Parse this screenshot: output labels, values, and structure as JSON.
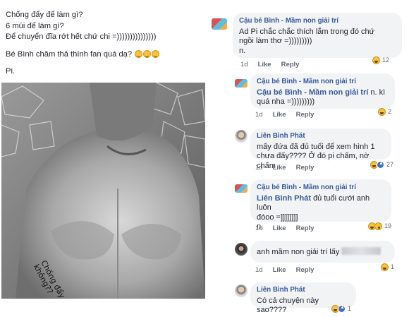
{
  "post": {
    "lines": [
      "Chống đẩy để làm gì?",
      "6 múi để làm gì?",
      "Để chuyển đĩa rớt hết chứ chi =)))))))))))))))",
      "Bé Bình chăm thả thính fan quá dạ?",
      "Pi."
    ],
    "photo_caption_line1": "Chống đẩy xíu",
    "photo_caption_line2": "không??",
    "emoji": "laughing-emoji"
  },
  "comments": [
    {
      "author": "Cậu bé Bình - Mầm non giải trí",
      "text_lines": [
        "Ad Pi chắc chắc thích lắm trong đó chứ",
        "ngồi làm thơ =)))))))))",
        "n."
      ],
      "time": "1d",
      "like": "Like",
      "reply": "Reply",
      "reactions": [
        "haha"
      ],
      "reaction_count": "12"
    },
    {
      "author": "Cậu bé Bình - Mầm non giải trí",
      "tag": "Cậu bé Bình - Mầm non giải trí",
      "text_lines": [
        "n. kì",
        "quá nha =)))))))))"
      ],
      "time": "1d",
      "like": "Like",
      "reply": "Reply",
      "reactions": [
        "haha"
      ],
      "reaction_count": "2"
    },
    {
      "author": "Liên Bình Phát",
      "text_lines": [
        "mấy đứa đã đủ tuổi để xem hình 1",
        "chưa đấy???? Ở đó pi chấm, nờ chấm"
      ],
      "time": "1d",
      "like": "Like",
      "reply": "Reply",
      "reactions": [
        "haha",
        "like"
      ],
      "reaction_count": "27"
    },
    {
      "author": "Cậu bé Bình - Mầm non giải trí",
      "tag": "Liên Bình Phát",
      "text_lines": [
        "đủ tuổi cưới anh luôn",
        "đóoo =]]]]]]]]",
        "n."
      ],
      "time": "1d",
      "like": "Like",
      "reply": "Reply",
      "reactions": [
        "haha",
        "wow"
      ],
      "reaction_count": "19"
    },
    {
      "author": "",
      "text_lines": [
        "anh mầm non giải trí lấy"
      ],
      "time": "1d",
      "like": "Like",
      "reply": "Reply",
      "reactions": [
        "haha"
      ],
      "reaction_count": "1"
    },
    {
      "author": "Liên Bình Phát",
      "text_lines": [
        "Có cả chuyện này sao????"
      ],
      "time": "",
      "like": "",
      "reply": "",
      "reactions": [
        "haha",
        "like"
      ],
      "reaction_count": "1"
    }
  ],
  "colors": {
    "link": "#385898",
    "bubble": "#f2f3f5",
    "meta": "#606770"
  }
}
